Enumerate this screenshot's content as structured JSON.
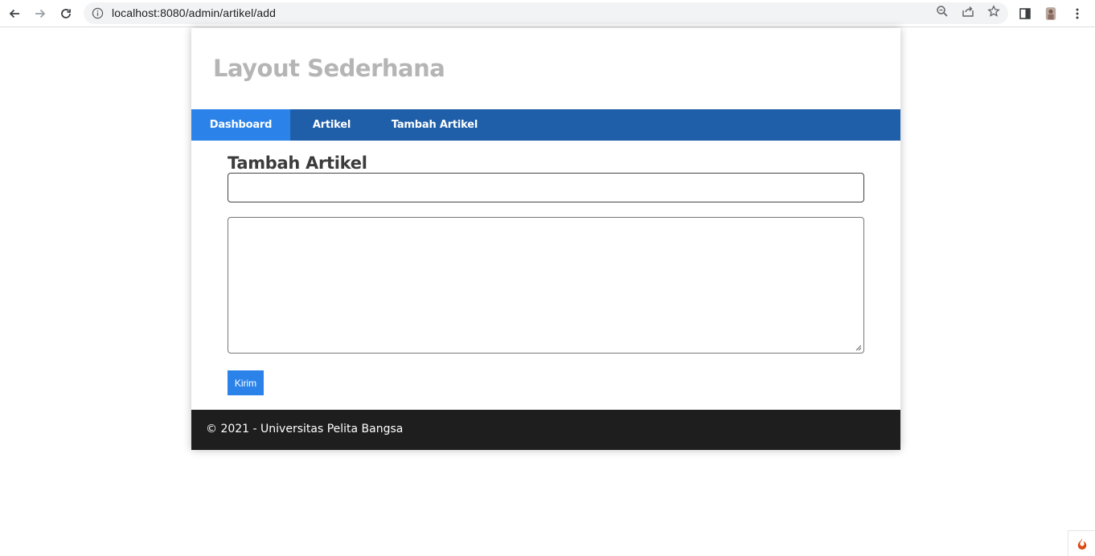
{
  "browser": {
    "url": "localhost:8080/admin/artikel/add"
  },
  "header": {
    "site_title": "Layout Sederhana"
  },
  "nav": {
    "items": [
      {
        "label": "Dashboard",
        "active": true
      },
      {
        "label": "Artikel",
        "active": false
      },
      {
        "label": "Tambah Artikel",
        "active": false
      }
    ]
  },
  "main": {
    "heading": "Tambah Artikel",
    "title_input": {
      "value": "",
      "placeholder": ""
    },
    "body_textarea": {
      "value": "",
      "placeholder": ""
    },
    "submit_label": "Kirim"
  },
  "footer": {
    "text": "© 2021 - Universitas Pelita Bangsa"
  },
  "colors": {
    "nav_bg": "#1f5faa",
    "nav_active": "#2b83ea",
    "button": "#2b83ea",
    "footer_bg": "#1e1e1e",
    "title_text": "#b5b5b5"
  }
}
